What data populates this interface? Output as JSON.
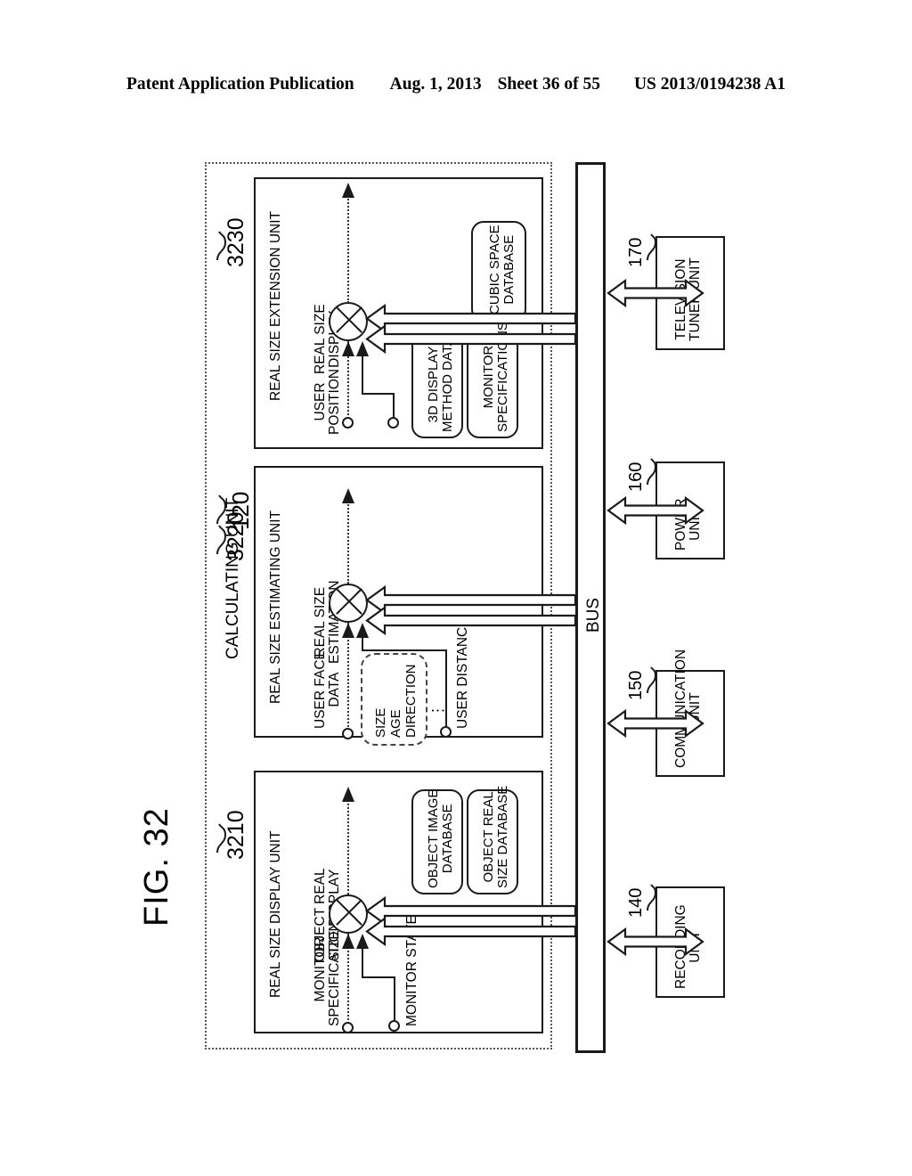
{
  "header": {
    "publication": "Patent Application Publication",
    "date": "Aug. 1, 2013",
    "sheet": "Sheet 36 of 55",
    "number": "US 2013/0194238 A1"
  },
  "figure": {
    "label": "FIG. 32"
  },
  "calculating_unit": {
    "label": "CALCULATING UNIT",
    "ref": "120"
  },
  "blocks": [
    {
      "ref": "3210",
      "title": "REAL SIZE DISPLAY UNIT",
      "output": "OBJECT REAL\nSIZE DISPLAY",
      "output_line1": "OBJECT REAL",
      "output_line2": "SIZE DISPLAY",
      "inputs": [
        {
          "line1": "MONITOR",
          "line2": "SPECIFICATIONS"
        },
        {
          "line1": "MONITOR STATE",
          "line2": ""
        }
      ],
      "databases": [
        {
          "line1": "OBJECT IMAGE",
          "line2": "DATABASE"
        },
        {
          "line1": "OBJECT REAL",
          "line2": "SIZE DATABASE"
        }
      ]
    },
    {
      "ref": "3220",
      "title": "REAL SIZE ESTIMATING UNIT",
      "output_line1": "REAL SIZE",
      "output_line2": "ESTIMATION",
      "inputs": [
        {
          "line1": "USER FACE",
          "line2": "DATA"
        },
        {
          "line1": "USER DISTANCE",
          "line2": ""
        }
      ],
      "subbox": {
        "line1": "SIZE",
        "line2": "AGE",
        "line3": "DIRECTION",
        "line4": "⋮"
      },
      "databases": []
    },
    {
      "ref": "3230",
      "title": "REAL SIZE EXTENSION UNIT",
      "output_line1": "REAL SIZE",
      "output_line2": "DISPLAY",
      "inputs": [
        {
          "line1": "USER",
          "line2": "POSITION"
        }
      ],
      "databases": [
        {
          "line1": "CUBIC SPACE",
          "line2": "DATABASE"
        },
        {
          "line1": "3D DISPLAY",
          "line2": "METHOD DATA"
        },
        {
          "line1": "MONITOR",
          "line2": "SPECIFICATIONS"
        }
      ]
    }
  ],
  "bus": {
    "label": "BUS"
  },
  "peripherals": [
    {
      "ref": "140",
      "line1": "RECORDING",
      "line2": "UNIT"
    },
    {
      "ref": "150",
      "line1": "COMMUNICATION",
      "line2": "UNIT"
    },
    {
      "ref": "160",
      "line1": "POWER",
      "line2": "UNIT"
    },
    {
      "ref": "170",
      "line1": "TELEVISION",
      "line2": "TUNER UNIT"
    }
  ],
  "colors": {
    "ink": "#1a1a1a",
    "paper": "#ffffff",
    "dashed": "#555555"
  }
}
